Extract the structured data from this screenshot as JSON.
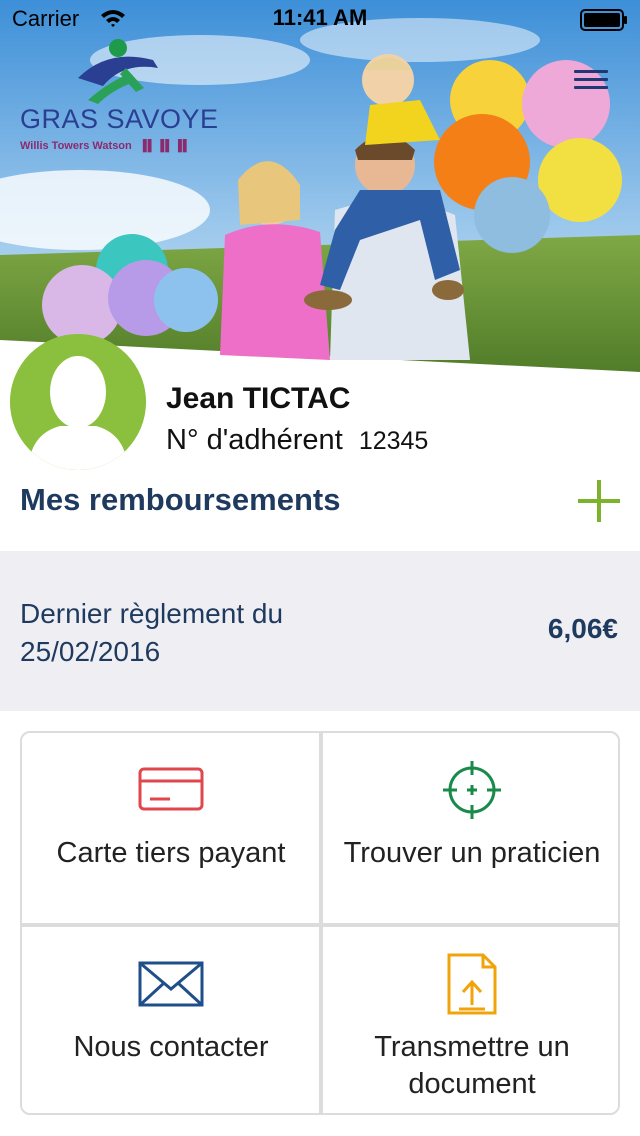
{
  "status_bar": {
    "carrier": "Carrier",
    "time": "11:41 AM"
  },
  "brand": {
    "name": "GRAS SAVOYE",
    "subtitle": "Willis Towers Watson",
    "colors": {
      "primary": "#2a3f91",
      "accent_green": "#7db32c",
      "dark_blue": "#1f3a5f"
    }
  },
  "header": {
    "menu_icon": "hamburger-icon",
    "hero_image": "family-with-balloons"
  },
  "profile": {
    "name": "Jean TICTAC",
    "member_label": "N° d'adhérent",
    "member_number": "12345"
  },
  "reimbursements": {
    "title": "Mes remboursements",
    "add_icon": "plus-icon",
    "last_payment_label": "Dernier règlement du 25/02/2016",
    "last_payment_amount": "6,06€"
  },
  "tiles": [
    {
      "label": "Carte tiers payant",
      "icon": "card-icon",
      "color": "#e0474c"
    },
    {
      "label": "Trouver un praticien",
      "icon": "target-icon",
      "color": "#1a8a4a"
    },
    {
      "label": "Nous contacter",
      "icon": "envelope-icon",
      "color": "#1f4f8a"
    },
    {
      "label": "Transmettre un document",
      "icon": "document-upload-icon",
      "color": "#f0a30a"
    }
  ]
}
